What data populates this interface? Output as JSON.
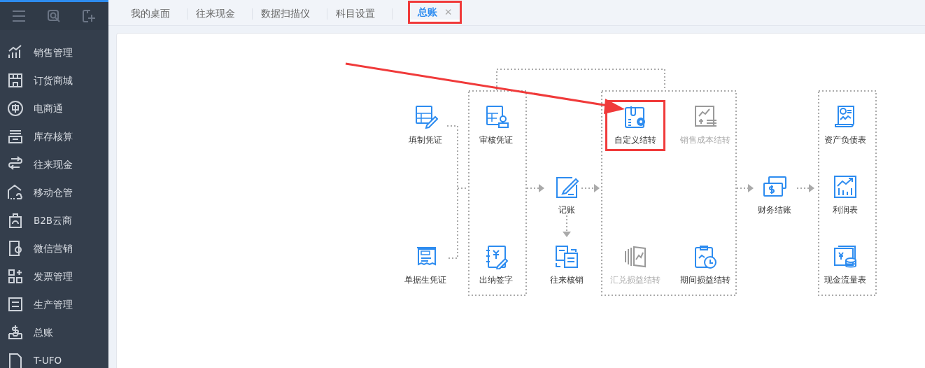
{
  "sidebar": {
    "items": [
      {
        "label": "销售管理"
      },
      {
        "label": "订货商城"
      },
      {
        "label": "电商通"
      },
      {
        "label": "库存核算"
      },
      {
        "label": "往来现金"
      },
      {
        "label": "移动仓管"
      },
      {
        "label": "B2B云商"
      },
      {
        "label": "微信营销"
      },
      {
        "label": "发票管理"
      },
      {
        "label": "生产管理"
      },
      {
        "label": "总账"
      },
      {
        "label": "T-UFO"
      }
    ]
  },
  "tabs": [
    {
      "label": "我的桌面",
      "selected": false,
      "highlighted": false
    },
    {
      "label": "往来现金",
      "selected": false,
      "highlighted": false
    },
    {
      "label": "数据扫描仪",
      "selected": false,
      "highlighted": false
    },
    {
      "label": "科目设置",
      "selected": false,
      "highlighted": false
    },
    {
      "label": "总账",
      "selected": true,
      "highlighted": true,
      "close": "✕"
    }
  ],
  "flow": {
    "nodes": [
      {
        "label": "填制凭证",
        "disabled": false,
        "highlighted": false
      },
      {
        "label": "单据生凭证",
        "disabled": false,
        "highlighted": false
      },
      {
        "label": "审核凭证",
        "disabled": false,
        "highlighted": false
      },
      {
        "label": "出纳签字",
        "disabled": false,
        "highlighted": false
      },
      {
        "label": "记账",
        "disabled": false,
        "highlighted": false
      },
      {
        "label": "往来核销",
        "disabled": false,
        "highlighted": false
      },
      {
        "label": "自定义结转",
        "disabled": false,
        "highlighted": true
      },
      {
        "label": "销售成本结转",
        "disabled": true,
        "highlighted": false
      },
      {
        "label": "汇兑损益结转",
        "disabled": true,
        "highlighted": false
      },
      {
        "label": "期间损益结转",
        "disabled": false,
        "highlighted": false
      },
      {
        "label": "财务结账",
        "disabled": false,
        "highlighted": false
      },
      {
        "label": "资产负债表",
        "disabled": false,
        "highlighted": false
      },
      {
        "label": "利润表",
        "disabled": false,
        "highlighted": false
      },
      {
        "label": "现金流量表",
        "disabled": false,
        "highlighted": false
      }
    ],
    "annotation_arrow": true
  }
}
